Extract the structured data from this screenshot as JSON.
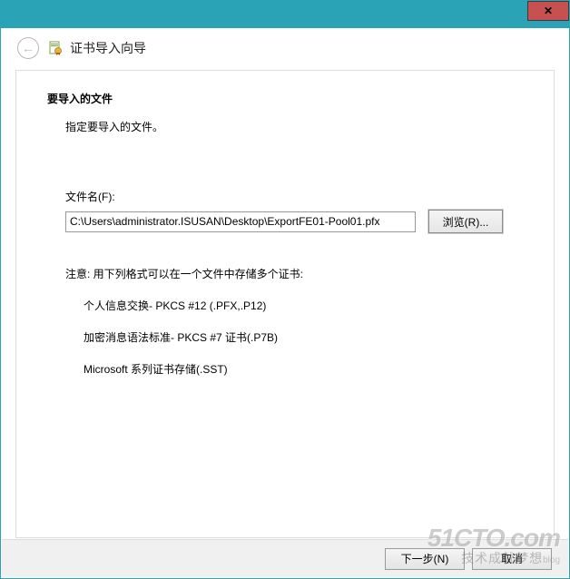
{
  "window": {
    "close_glyph": "✕"
  },
  "header": {
    "back_glyph": "←",
    "title": "证书导入向导"
  },
  "content": {
    "heading": "要导入的文件",
    "description": "指定要导入的文件。",
    "file_label": "文件名(F):",
    "file_value": "C:\\Users\\administrator.ISUSAN\\Desktop\\ExportFE01-Pool01.pfx",
    "browse_label": "浏览(R)...",
    "note": "注意: 用下列格式可以在一个文件中存储多个证书:",
    "formats": {
      "f1": "个人信息交换- PKCS #12 (.PFX,.P12)",
      "f2": "加密消息语法标准- PKCS #7 证书(.P7B)",
      "f3": "Microsoft 系列证书存储(.SST)"
    }
  },
  "footer": {
    "next_label": "下一步(N)",
    "cancel_label": "取消"
  },
  "watermark": {
    "main": "51CTO.com",
    "sub_cn": "技术成就梦想",
    "sub_en": "blog"
  }
}
